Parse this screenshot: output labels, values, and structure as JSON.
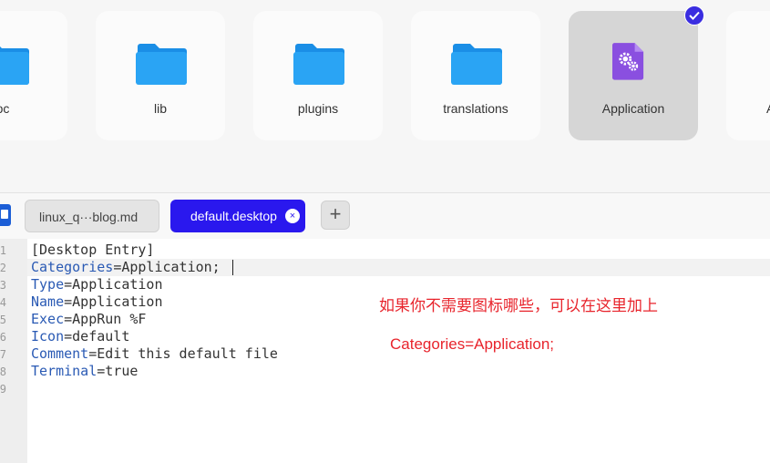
{
  "file_manager": {
    "items": [
      {
        "label": "oc",
        "icon": "folder-icon",
        "selected": false
      },
      {
        "label": "lib",
        "icon": "folder-icon",
        "selected": false
      },
      {
        "label": "plugins",
        "icon": "folder-icon",
        "selected": false
      },
      {
        "label": "translations",
        "icon": "folder-icon",
        "selected": false
      },
      {
        "label": "Application",
        "icon": "application-settings-icon",
        "selected": true
      },
      {
        "label": "A",
        "icon": "folder-icon",
        "selected": false
      }
    ]
  },
  "editor": {
    "tabs": [
      {
        "label": "linux_q···blog.md",
        "active": false
      },
      {
        "label": "default.desktop",
        "active": true
      }
    ],
    "close_symbol": "×",
    "new_tab_symbol": "+",
    "line_numbers": [
      "1",
      "2",
      "3",
      "4",
      "5",
      "6",
      "7",
      "8",
      "9"
    ],
    "lines": [
      {
        "key": "",
        "eq": "",
        "value": "[Desktop Entry]"
      },
      {
        "key": "Categories",
        "eq": "=",
        "value": "Application;"
      },
      {
        "key": "Type",
        "eq": "=",
        "value": "Application"
      },
      {
        "key": "Name",
        "eq": "=",
        "value": "Application"
      },
      {
        "key": "Exec",
        "eq": "=",
        "value": "AppRun %F"
      },
      {
        "key": "Icon",
        "eq": "=",
        "value": "default"
      },
      {
        "key": "Comment",
        "eq": "=",
        "value": "Edit this default file"
      },
      {
        "key": "Terminal",
        "eq": "=",
        "value": "true"
      },
      {
        "key": "",
        "eq": "",
        "value": ""
      }
    ]
  },
  "annotations": {
    "line1": "如果你不需要图标哪些，可以在这里加上",
    "line2": "Categories=Application;"
  },
  "colors": {
    "folder": "#1e9af0",
    "active_tab": "#2a18ee",
    "annotation": "#e8242c",
    "key": "#2a5ab4"
  }
}
